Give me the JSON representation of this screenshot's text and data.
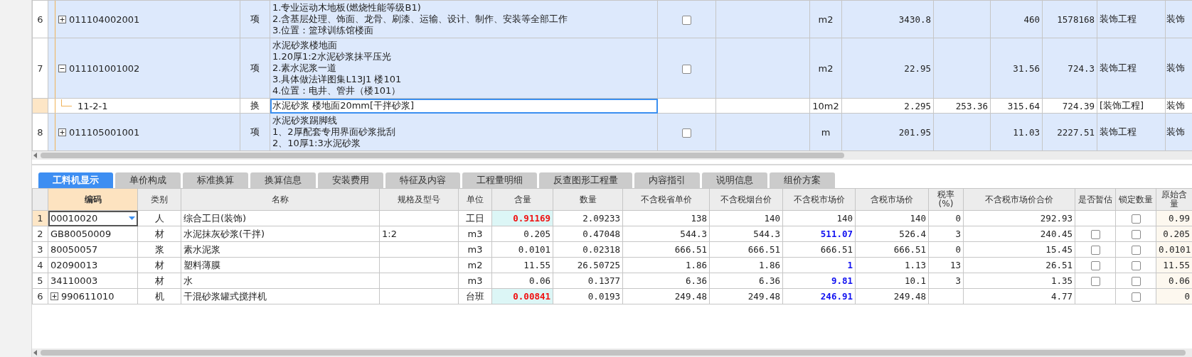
{
  "top_grid": {
    "rows": [
      {
        "number": "6",
        "code": "011104002001",
        "type": "项",
        "description": [
          "1.专业运动木地板(燃烧性能等级B1)",
          "2.含基层处理、饰面、龙骨、刷漆、运输、设计、制作、安装等全部工作",
          "3.位置：篮球训练馆楼面"
        ],
        "checked": false,
        "unit": "m2",
        "quantity": "3430.8",
        "column_8": "",
        "column_9": "460",
        "column_10": "1578168",
        "column_11": "装饰工程",
        "column_12": "装饰",
        "expanded": false,
        "selected": false
      },
      {
        "number": "7",
        "code": "011101001002",
        "type": "项",
        "description": [
          "水泥砂浆楼地面",
          "1.20厚1:2水泥砂浆抹平压光",
          "2.素水泥浆一道",
          "3.具体做法详图集L13J1 楼101",
          "4.位置：电井、管井（楼101）"
        ],
        "checked": false,
        "unit": "m2",
        "quantity": "22.95",
        "column_8": "",
        "column_9": "31.56",
        "column_10": "724.3",
        "column_11": "装饰工程",
        "column_12": "装饰",
        "expanded": true,
        "selected": false,
        "children": [
          {
            "code": "11-2-1",
            "type": "换",
            "description": [
              "水泥砂浆 楼地面20mm[干拌砂浆]"
            ],
            "unit": "10m2",
            "quantity": "2.295",
            "column_8": "253.36",
            "column_9": "315.64",
            "column_10": "724.39",
            "column_11": "[装饰工程]",
            "column_12": "装饰",
            "selected": true
          }
        ]
      },
      {
        "number": "8",
        "code": "011105001001",
        "type": "项",
        "description": [
          "水泥砂浆踢脚线",
          "1、2厚配套专用界面砂浆批刮",
          "2、10厚1:3水泥砂浆"
        ],
        "checked": false,
        "unit": "m",
        "quantity": "201.95",
        "column_8": "",
        "column_9": "11.03",
        "column_10": "2227.51",
        "column_11": "装饰工程",
        "column_12": "装饰",
        "expanded": false,
        "selected": false
      }
    ]
  },
  "tabs": [
    {
      "label": "工料机显示",
      "selected": true
    },
    {
      "label": "单价构成",
      "selected": false
    },
    {
      "label": "标准换算",
      "selected": false
    },
    {
      "label": "换算信息",
      "selected": false
    },
    {
      "label": "安装费用",
      "selected": false
    },
    {
      "label": "特征及内容",
      "selected": false
    },
    {
      "label": "工程量明细",
      "selected": false
    },
    {
      "label": "反查图形工程量",
      "selected": false
    },
    {
      "label": "内容指引",
      "selected": false
    },
    {
      "label": "说明信息",
      "selected": false
    },
    {
      "label": "组价方案",
      "selected": false
    }
  ],
  "materials": {
    "columns": [
      {
        "label": "编码",
        "selected": true
      },
      {
        "label": "类别",
        "selected": false
      },
      {
        "label": "名称",
        "selected": false
      },
      {
        "label": "规格及型号",
        "selected": false
      },
      {
        "label": "单位",
        "selected": false
      },
      {
        "label": "含量",
        "selected": false
      },
      {
        "label": "数量",
        "selected": false
      },
      {
        "label": "不含税省单价",
        "selected": false
      },
      {
        "label": "不含税烟台价",
        "selected": false
      },
      {
        "label": "不含税市场价",
        "selected": false
      },
      {
        "label": "含税市场价",
        "selected": false
      },
      {
        "label": "税率(%)",
        "selected": false
      },
      {
        "label": "不含税市场价合价",
        "selected": false
      },
      {
        "label": "是否暂估",
        "selected": false
      },
      {
        "label": "锁定数量",
        "selected": false
      },
      {
        "label": "原始含量",
        "selected": false
      }
    ],
    "rows": [
      {
        "number": "1",
        "code": "00010020",
        "category": "人",
        "name": "综合工日(装饰)",
        "spec": "",
        "unit": "工日",
        "content": "0.91169",
        "content_adjusted": true,
        "quantity": "2.09233",
        "province_price": "138",
        "yantai_price": "140",
        "market_price": "140",
        "market_price_adjusted": false,
        "market_price_tax": "140",
        "tax_rate": "0",
        "total": "292.93",
        "locked": false,
        "original": "0.99",
        "selected": true
      },
      {
        "number": "2",
        "code": "GB80050009",
        "category": "材",
        "name": "水泥抹灰砂浆(干拌)",
        "spec": "1:2",
        "unit": "m3",
        "content": "0.205",
        "content_adjusted": false,
        "quantity": "0.47048",
        "province_price": "544.3",
        "yantai_price": "544.3",
        "market_price": "511.07",
        "market_price_adjusted": true,
        "market_price_tax": "526.4",
        "tax_rate": "3",
        "total": "240.45",
        "estimated": false,
        "locked": false,
        "original": "0.205",
        "selected": false
      },
      {
        "number": "3",
        "code": "80050057",
        "category": "浆",
        "name": "素水泥浆",
        "spec": "",
        "unit": "m3",
        "content": "0.0101",
        "content_adjusted": false,
        "quantity": "0.02318",
        "province_price": "666.51",
        "yantai_price": "666.51",
        "market_price": "666.51",
        "market_price_adjusted": false,
        "market_price_tax": "666.51",
        "tax_rate": "0",
        "total": "15.45",
        "estimated": false,
        "locked": false,
        "original": "0.0101",
        "selected": false
      },
      {
        "number": "4",
        "code": "02090013",
        "category": "材",
        "name": "塑料薄膜",
        "spec": "",
        "unit": "m2",
        "content": "11.55",
        "content_adjusted": false,
        "quantity": "26.50725",
        "province_price": "1.86",
        "yantai_price": "1.86",
        "market_price": "1",
        "market_price_adjusted": true,
        "market_price_tax": "1.13",
        "tax_rate": "13",
        "total": "26.51",
        "estimated": false,
        "locked": false,
        "original": "11.55",
        "selected": false
      },
      {
        "number": "5",
        "code": "34110003",
        "category": "材",
        "name": "水",
        "spec": "",
        "unit": "m3",
        "content": "0.06",
        "content_adjusted": false,
        "quantity": "0.1377",
        "province_price": "6.36",
        "yantai_price": "6.36",
        "market_price": "9.81",
        "market_price_adjusted": true,
        "market_price_tax": "10.1",
        "tax_rate": "3",
        "total": "1.35",
        "estimated": false,
        "locked": false,
        "original": "0.06",
        "selected": false
      },
      {
        "number": "6",
        "code": "990611010",
        "category": "机",
        "name": "干混砂浆罐式搅拌机",
        "spec": "",
        "unit": "台班",
        "content": "0.00841",
        "content_adjusted": true,
        "quantity": "0.0193",
        "province_price": "249.48",
        "yantai_price": "249.48",
        "market_price": "246.91",
        "market_price_adjusted": true,
        "market_price_tax": "249.48",
        "tax_rate": "",
        "total": "4.77",
        "locked": false,
        "original": "0",
        "expanded": false,
        "selected": false
      }
    ]
  }
}
